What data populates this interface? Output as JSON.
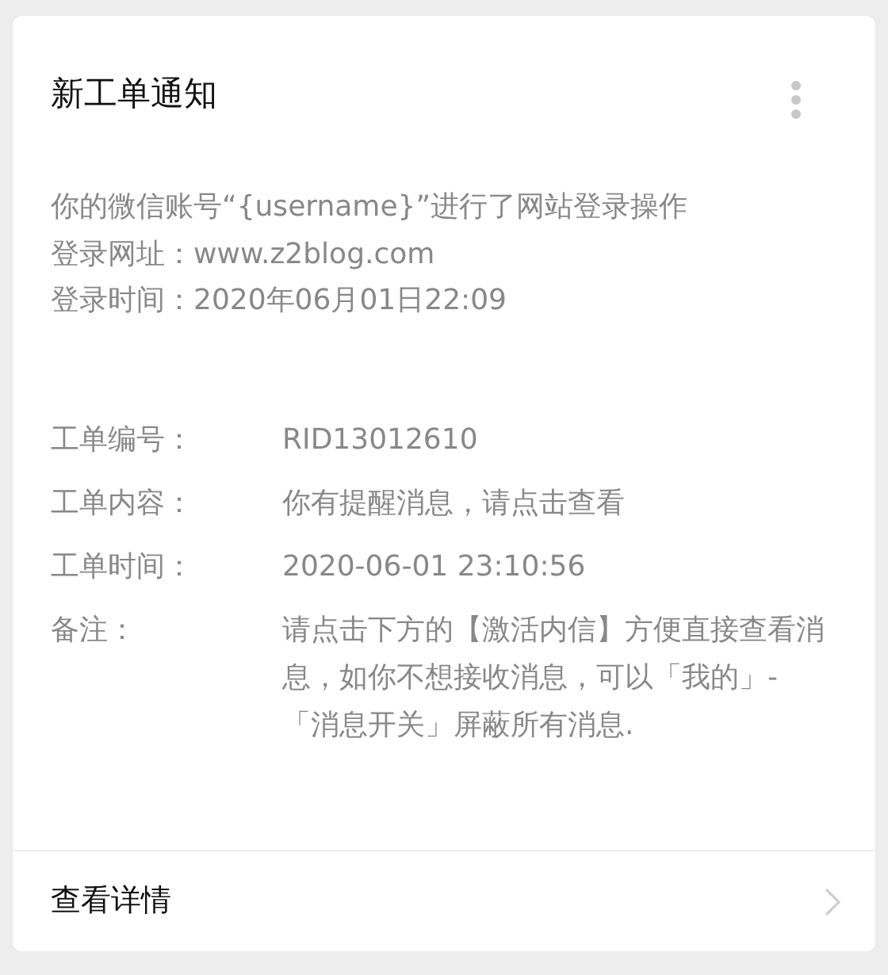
{
  "title": "新工单通知",
  "intro": [
    "你的微信账号“{username}”进行了网站登录操作",
    "登录网址：www.z2blog.com",
    "登录时间：2020年06月01日22:09"
  ],
  "fields": [
    {
      "label": "工单编号：",
      "value": "RID13012610"
    },
    {
      "label": "工单内容：",
      "value": "你有提醒消息，请点击查看"
    },
    {
      "label": "工单时间：",
      "value": "2020-06-01 23:10:56"
    },
    {
      "label": "备注：",
      "value": "请点击下方的【激活内信】方便直接查看消息，如你不想接收消息，可以「我的」-「消息开关」屏蔽所有消息."
    }
  ],
  "footer": {
    "label": "查看详情"
  }
}
